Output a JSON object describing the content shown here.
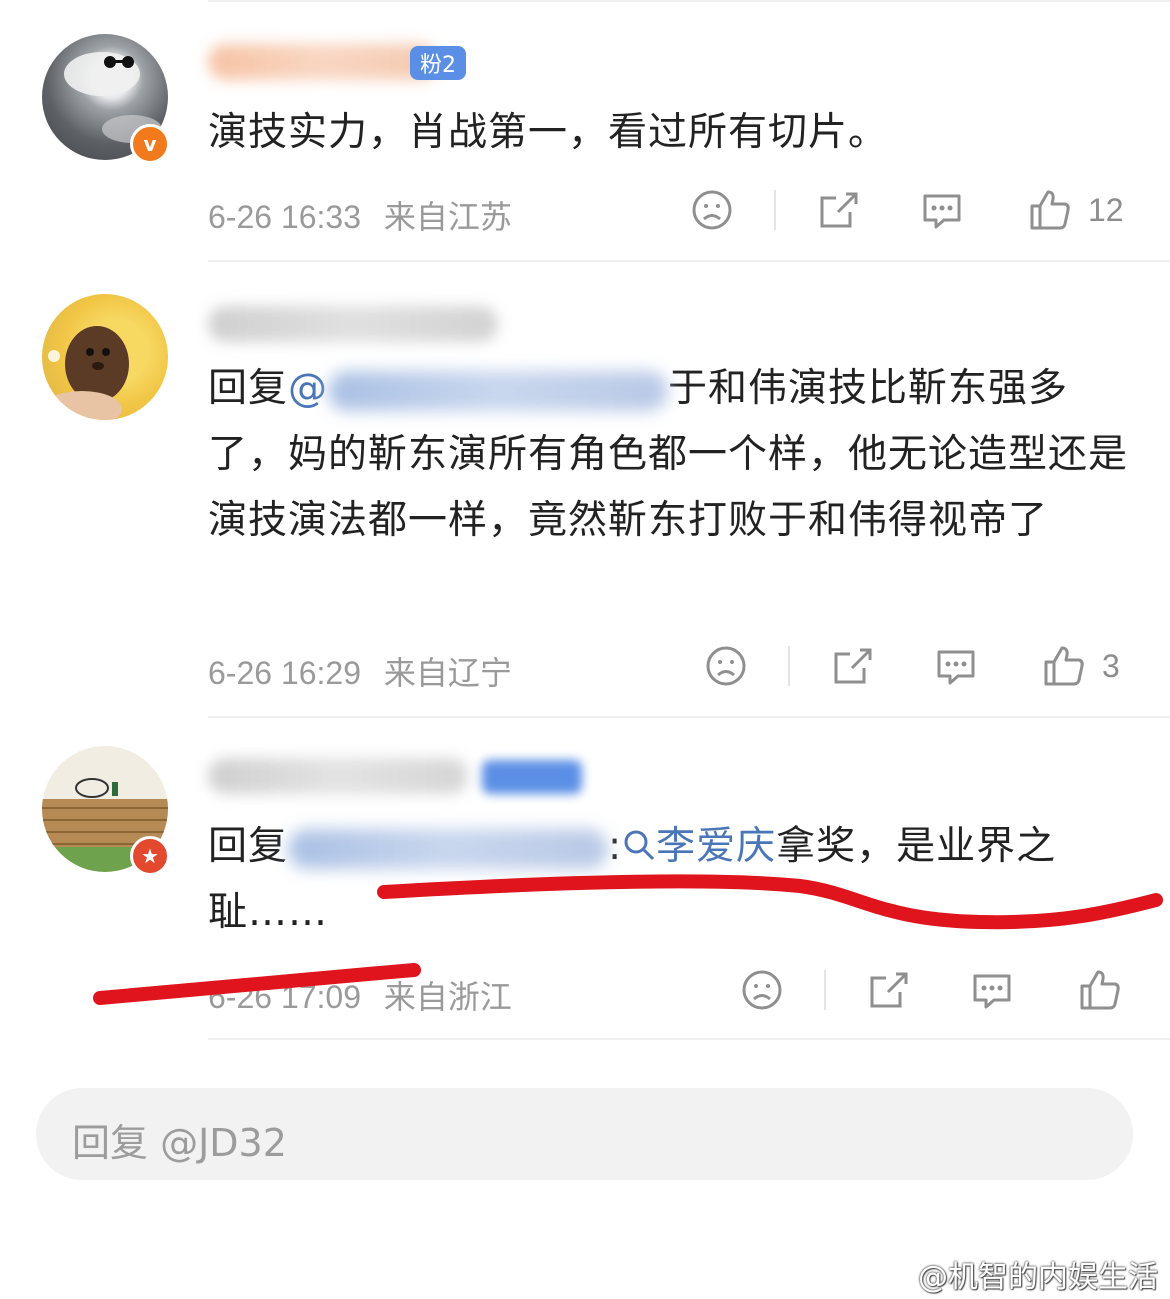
{
  "comments": [
    {
      "fan_badge": "粉2",
      "text": "演技实力，肖战第一，看过所有切片。",
      "time": "6-26 16:33",
      "location": "来自江苏",
      "likes": "12"
    },
    {
      "reply_prefix": "回复",
      "mention_visible": "@",
      "text_after": "于和伟演技比靳东强多了，妈的靳东演所有角色都一个样，他无论造型还是演技演法都一样，竟然靳东打败于和伟得视帝了",
      "time": "6-26 16:29",
      "location": "来自辽宁",
      "likes": "3"
    },
    {
      "reply_prefix": "回复",
      "separator": ":",
      "search_mention": "李爱庆",
      "text_after": "拿奖，是业界之耻……",
      "time_partial": "6-26 17:09",
      "location": "来自浙江",
      "likes": ""
    }
  ],
  "reply_bar": {
    "placeholder": "回复 @JD32"
  },
  "watermark": {
    "text": "@机智的内娱生活"
  },
  "colors": {
    "accent_orange": "#f07a1c",
    "red_badge": "#e2492e",
    "mention_blue": "#4a76b8",
    "red_annotation": "#e0141c"
  }
}
